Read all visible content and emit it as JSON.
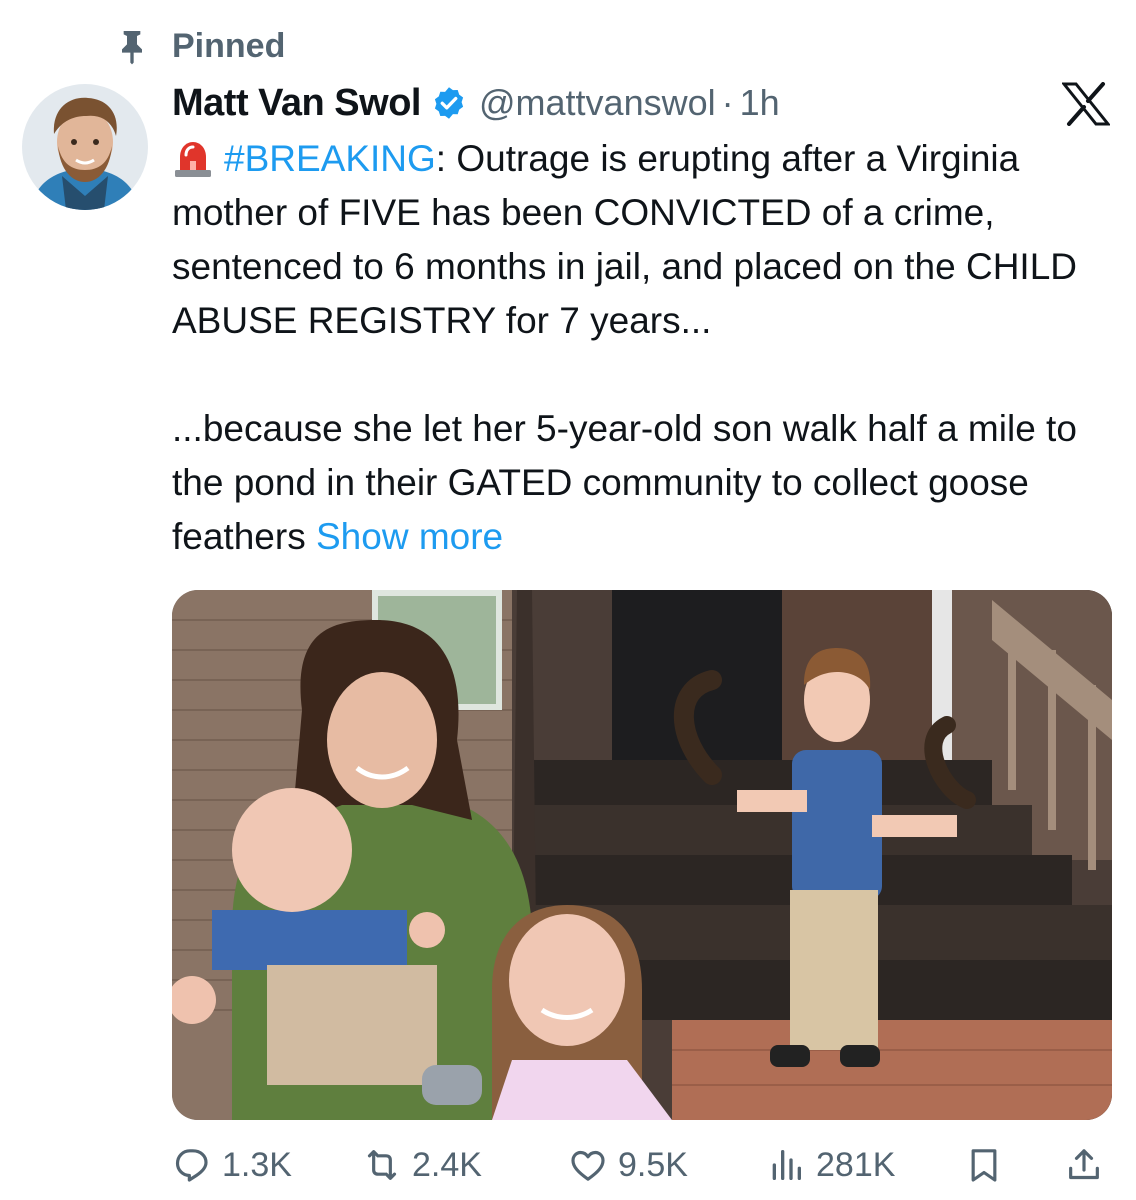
{
  "pinned_label": "Pinned",
  "author": {
    "display_name": "Matt Van Swol",
    "handle": "@mattvanswol",
    "separator": "·",
    "time": "1h",
    "verified": true
  },
  "post": {
    "hashtag": "#BREAKING",
    "line1_rest": ": Outrage is erupting after a Virginia mother of FIVE has been CONVICTED of a crime, sentenced to 6 months in jail, and placed on the CHILD ABUSE REGISTRY for 7 years...",
    "paragraph2": "...because she let her 5-year-old son walk half a mile to the pond in their GATED community to collect goose feathers",
    "show_more": "Show more"
  },
  "actions": {
    "replies": "1.3K",
    "reposts": "2.4K",
    "likes": "9.5K",
    "views": "281K"
  },
  "colors": {
    "link": "#1d9bf0",
    "secondary_text": "#536471",
    "verified_badge": "#1d9bf0"
  },
  "icons": [
    "pin-icon",
    "verified-icon",
    "x-logo-icon",
    "siren-icon",
    "reply-icon",
    "retweet-icon",
    "heart-icon",
    "views-icon",
    "bookmark-icon",
    "share-icon"
  ]
}
